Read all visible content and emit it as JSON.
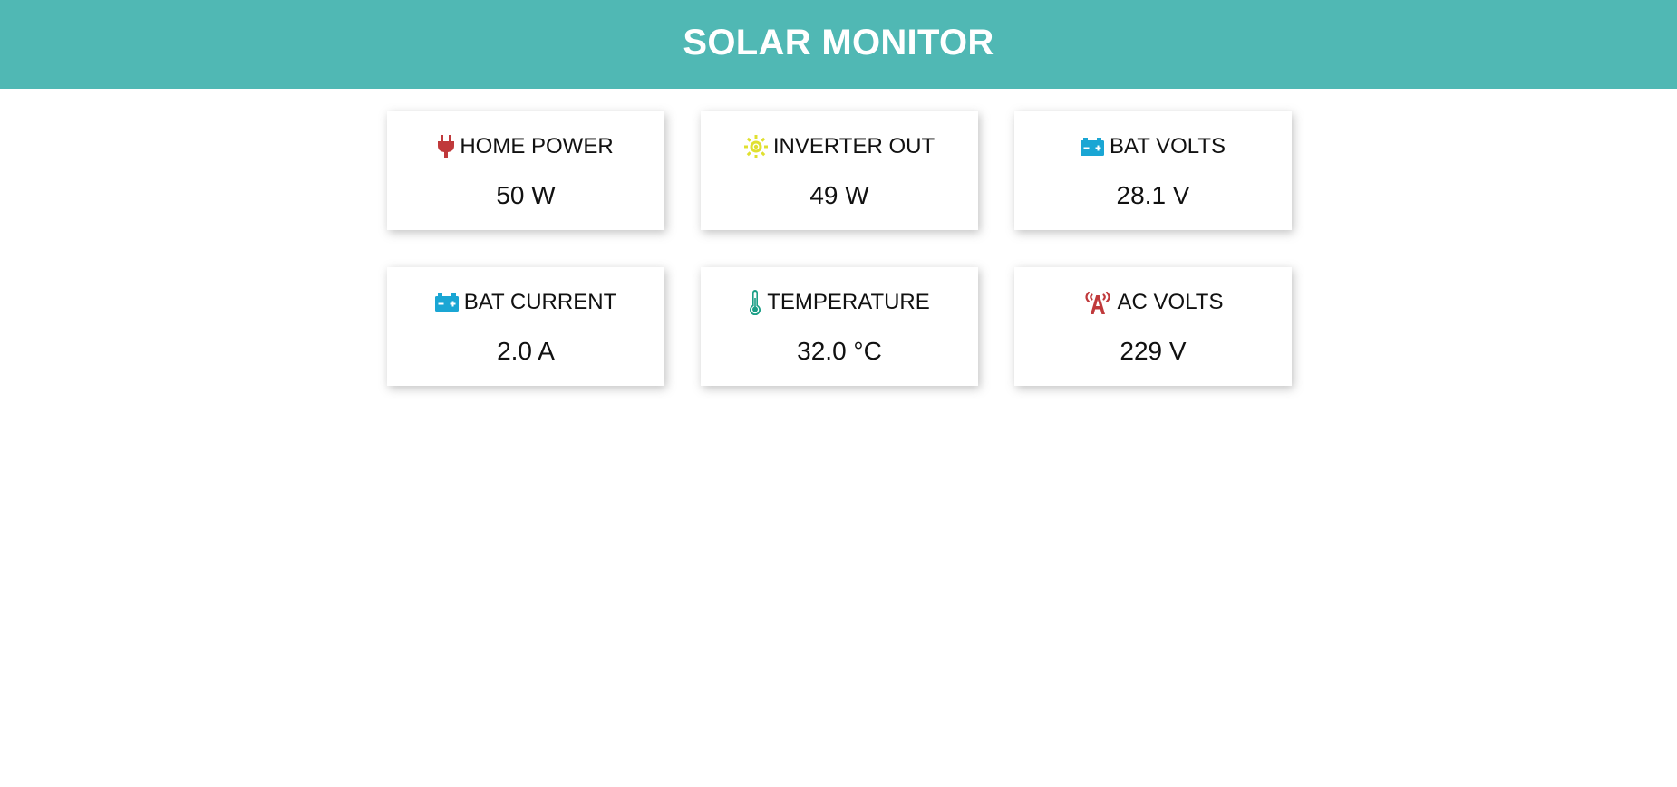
{
  "header": {
    "title": "SOLAR MONITOR",
    "background": "#50b8b4"
  },
  "cards": [
    {
      "label": "HOME POWER",
      "value": "50 W",
      "icon": "plug-icon",
      "icon_color": "#c0393b"
    },
    {
      "label": "INVERTER OUT",
      "value": "49 W",
      "icon": "sun-icon",
      "icon_color": "#e0e030"
    },
    {
      "label": "BAT VOLTS",
      "value": "28.1 V",
      "icon": "battery-icon",
      "icon_color": "#1aa6d4"
    },
    {
      "label": "BAT CURRENT",
      "value": "2.0 A",
      "icon": "battery-icon",
      "icon_color": "#1aa6d4"
    },
    {
      "label": "TEMPERATURE",
      "value": "32.0 °C",
      "icon": "thermometer-icon",
      "icon_color": "#1a9e86"
    },
    {
      "label": "AC VOLTS",
      "value": "229 V",
      "icon": "broadcast-tower-icon",
      "icon_color": "#c0393b"
    }
  ]
}
